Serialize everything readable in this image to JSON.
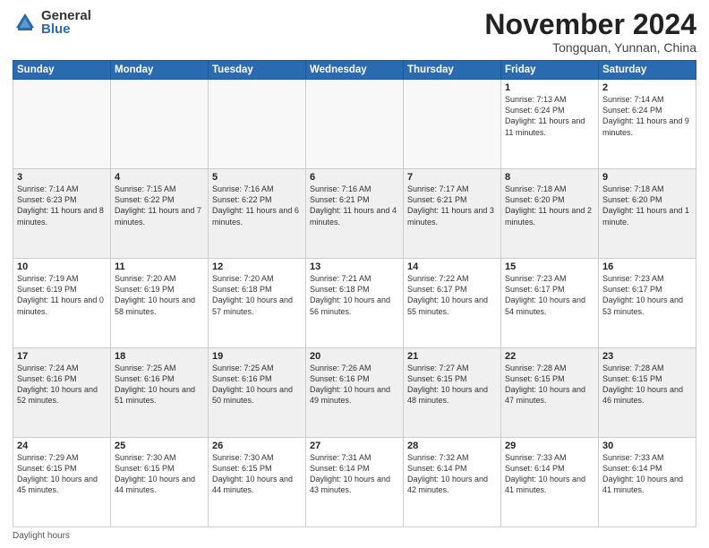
{
  "logo": {
    "general": "General",
    "blue": "Blue"
  },
  "title": "November 2024",
  "subtitle": "Tongquan, Yunnan, China",
  "days_of_week": [
    "Sunday",
    "Monday",
    "Tuesday",
    "Wednesday",
    "Thursday",
    "Friday",
    "Saturday"
  ],
  "footer": "Daylight hours",
  "weeks": [
    [
      {
        "day": "",
        "info": "",
        "empty": true
      },
      {
        "day": "",
        "info": "",
        "empty": true
      },
      {
        "day": "",
        "info": "",
        "empty": true
      },
      {
        "day": "",
        "info": "",
        "empty": true
      },
      {
        "day": "",
        "info": "",
        "empty": true
      },
      {
        "day": "1",
        "info": "Sunrise: 7:13 AM\nSunset: 6:24 PM\nDaylight: 11 hours and 11 minutes."
      },
      {
        "day": "2",
        "info": "Sunrise: 7:14 AM\nSunset: 6:24 PM\nDaylight: 11 hours and 9 minutes."
      }
    ],
    [
      {
        "day": "3",
        "info": "Sunrise: 7:14 AM\nSunset: 6:23 PM\nDaylight: 11 hours and 8 minutes.",
        "shaded": true
      },
      {
        "day": "4",
        "info": "Sunrise: 7:15 AM\nSunset: 6:22 PM\nDaylight: 11 hours and 7 minutes.",
        "shaded": true
      },
      {
        "day": "5",
        "info": "Sunrise: 7:16 AM\nSunset: 6:22 PM\nDaylight: 11 hours and 6 minutes.",
        "shaded": true
      },
      {
        "day": "6",
        "info": "Sunrise: 7:16 AM\nSunset: 6:21 PM\nDaylight: 11 hours and 4 minutes.",
        "shaded": true
      },
      {
        "day": "7",
        "info": "Sunrise: 7:17 AM\nSunset: 6:21 PM\nDaylight: 11 hours and 3 minutes.",
        "shaded": true
      },
      {
        "day": "8",
        "info": "Sunrise: 7:18 AM\nSunset: 6:20 PM\nDaylight: 11 hours and 2 minutes.",
        "shaded": true
      },
      {
        "day": "9",
        "info": "Sunrise: 7:18 AM\nSunset: 6:20 PM\nDaylight: 11 hours and 1 minute.",
        "shaded": true
      }
    ],
    [
      {
        "day": "10",
        "info": "Sunrise: 7:19 AM\nSunset: 6:19 PM\nDaylight: 11 hours and 0 minutes."
      },
      {
        "day": "11",
        "info": "Sunrise: 7:20 AM\nSunset: 6:19 PM\nDaylight: 10 hours and 58 minutes."
      },
      {
        "day": "12",
        "info": "Sunrise: 7:20 AM\nSunset: 6:18 PM\nDaylight: 10 hours and 57 minutes."
      },
      {
        "day": "13",
        "info": "Sunrise: 7:21 AM\nSunset: 6:18 PM\nDaylight: 10 hours and 56 minutes."
      },
      {
        "day": "14",
        "info": "Sunrise: 7:22 AM\nSunset: 6:17 PM\nDaylight: 10 hours and 55 minutes."
      },
      {
        "day": "15",
        "info": "Sunrise: 7:23 AM\nSunset: 6:17 PM\nDaylight: 10 hours and 54 minutes."
      },
      {
        "day": "16",
        "info": "Sunrise: 7:23 AM\nSunset: 6:17 PM\nDaylight: 10 hours and 53 minutes."
      }
    ],
    [
      {
        "day": "17",
        "info": "Sunrise: 7:24 AM\nSunset: 6:16 PM\nDaylight: 10 hours and 52 minutes.",
        "shaded": true
      },
      {
        "day": "18",
        "info": "Sunrise: 7:25 AM\nSunset: 6:16 PM\nDaylight: 10 hours and 51 minutes.",
        "shaded": true
      },
      {
        "day": "19",
        "info": "Sunrise: 7:25 AM\nSunset: 6:16 PM\nDaylight: 10 hours and 50 minutes.",
        "shaded": true
      },
      {
        "day": "20",
        "info": "Sunrise: 7:26 AM\nSunset: 6:16 PM\nDaylight: 10 hours and 49 minutes.",
        "shaded": true
      },
      {
        "day": "21",
        "info": "Sunrise: 7:27 AM\nSunset: 6:15 PM\nDaylight: 10 hours and 48 minutes.",
        "shaded": true
      },
      {
        "day": "22",
        "info": "Sunrise: 7:28 AM\nSunset: 6:15 PM\nDaylight: 10 hours and 47 minutes.",
        "shaded": true
      },
      {
        "day": "23",
        "info": "Sunrise: 7:28 AM\nSunset: 6:15 PM\nDaylight: 10 hours and 46 minutes.",
        "shaded": true
      }
    ],
    [
      {
        "day": "24",
        "info": "Sunrise: 7:29 AM\nSunset: 6:15 PM\nDaylight: 10 hours and 45 minutes."
      },
      {
        "day": "25",
        "info": "Sunrise: 7:30 AM\nSunset: 6:15 PM\nDaylight: 10 hours and 44 minutes."
      },
      {
        "day": "26",
        "info": "Sunrise: 7:30 AM\nSunset: 6:15 PM\nDaylight: 10 hours and 44 minutes."
      },
      {
        "day": "27",
        "info": "Sunrise: 7:31 AM\nSunset: 6:14 PM\nDaylight: 10 hours and 43 minutes."
      },
      {
        "day": "28",
        "info": "Sunrise: 7:32 AM\nSunset: 6:14 PM\nDaylight: 10 hours and 42 minutes."
      },
      {
        "day": "29",
        "info": "Sunrise: 7:33 AM\nSunset: 6:14 PM\nDaylight: 10 hours and 41 minutes."
      },
      {
        "day": "30",
        "info": "Sunrise: 7:33 AM\nSunset: 6:14 PM\nDaylight: 10 hours and 41 minutes."
      }
    ]
  ]
}
